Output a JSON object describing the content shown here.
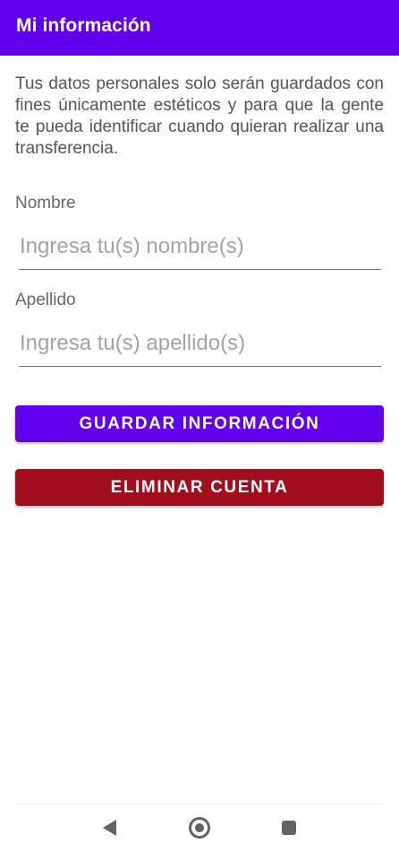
{
  "app_bar": {
    "title": "Mi información",
    "color": "#6200ee"
  },
  "description": "Tus datos personales solo serán guardados con fines únicamente estéticos y para que la gente te pueda identificar cuando quieran realizar una transferencia.",
  "form": {
    "first_name": {
      "label": "Nombre",
      "value": "",
      "placeholder": "Ingresa tu(s) nombre(s)"
    },
    "last_name": {
      "label": "Apellido",
      "value": "",
      "placeholder": "Ingresa tu(s) apellido(s)"
    }
  },
  "buttons": {
    "save": {
      "label": "GUARDAR INFORMACIÓN",
      "color": "#6200ee"
    },
    "delete": {
      "label": "ELIMINAR CUENTA",
      "color": "#a20d1e"
    }
  },
  "nav_bar": {
    "back_icon": "back-triangle-icon",
    "home_icon": "home-circle-icon",
    "recents_icon": "recents-square-icon"
  }
}
